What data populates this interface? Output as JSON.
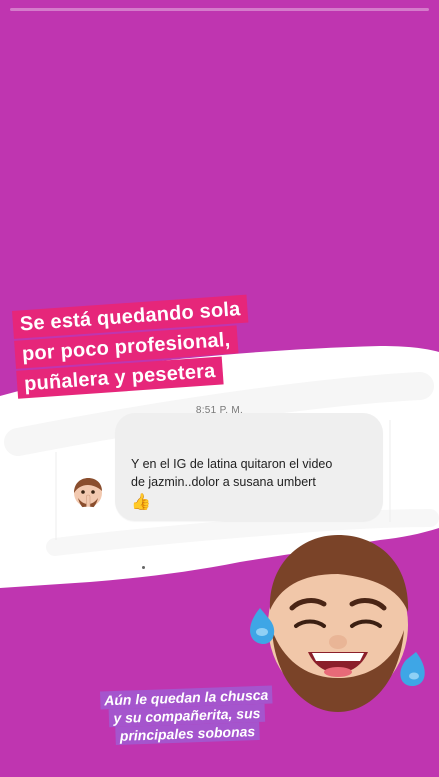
{
  "story": {
    "background_color": "#bf35b0",
    "progress_fraction": 0.0
  },
  "caption": {
    "lines": [
      "Se está quedando sola",
      "por poco profesional,",
      "puñalera y pesetera"
    ],
    "highlight_color": "#e6267a"
  },
  "chat": {
    "timestamp": "8:51 P. M.",
    "message_line1": "Y en el IG de latina quitaron el video",
    "message_line2": "de jazmin..dolor a susana umbert",
    "message_emoji": "👍",
    "avatar_icon": "memoji-shush-avatar-icon"
  },
  "sticker": {
    "icon": "memoji-laughing-tears-icon"
  },
  "bottom_caption": {
    "lines": [
      "Aún le quedan la chusca",
      "y  su compañerita, sus",
      "principales sobonas"
    ]
  }
}
